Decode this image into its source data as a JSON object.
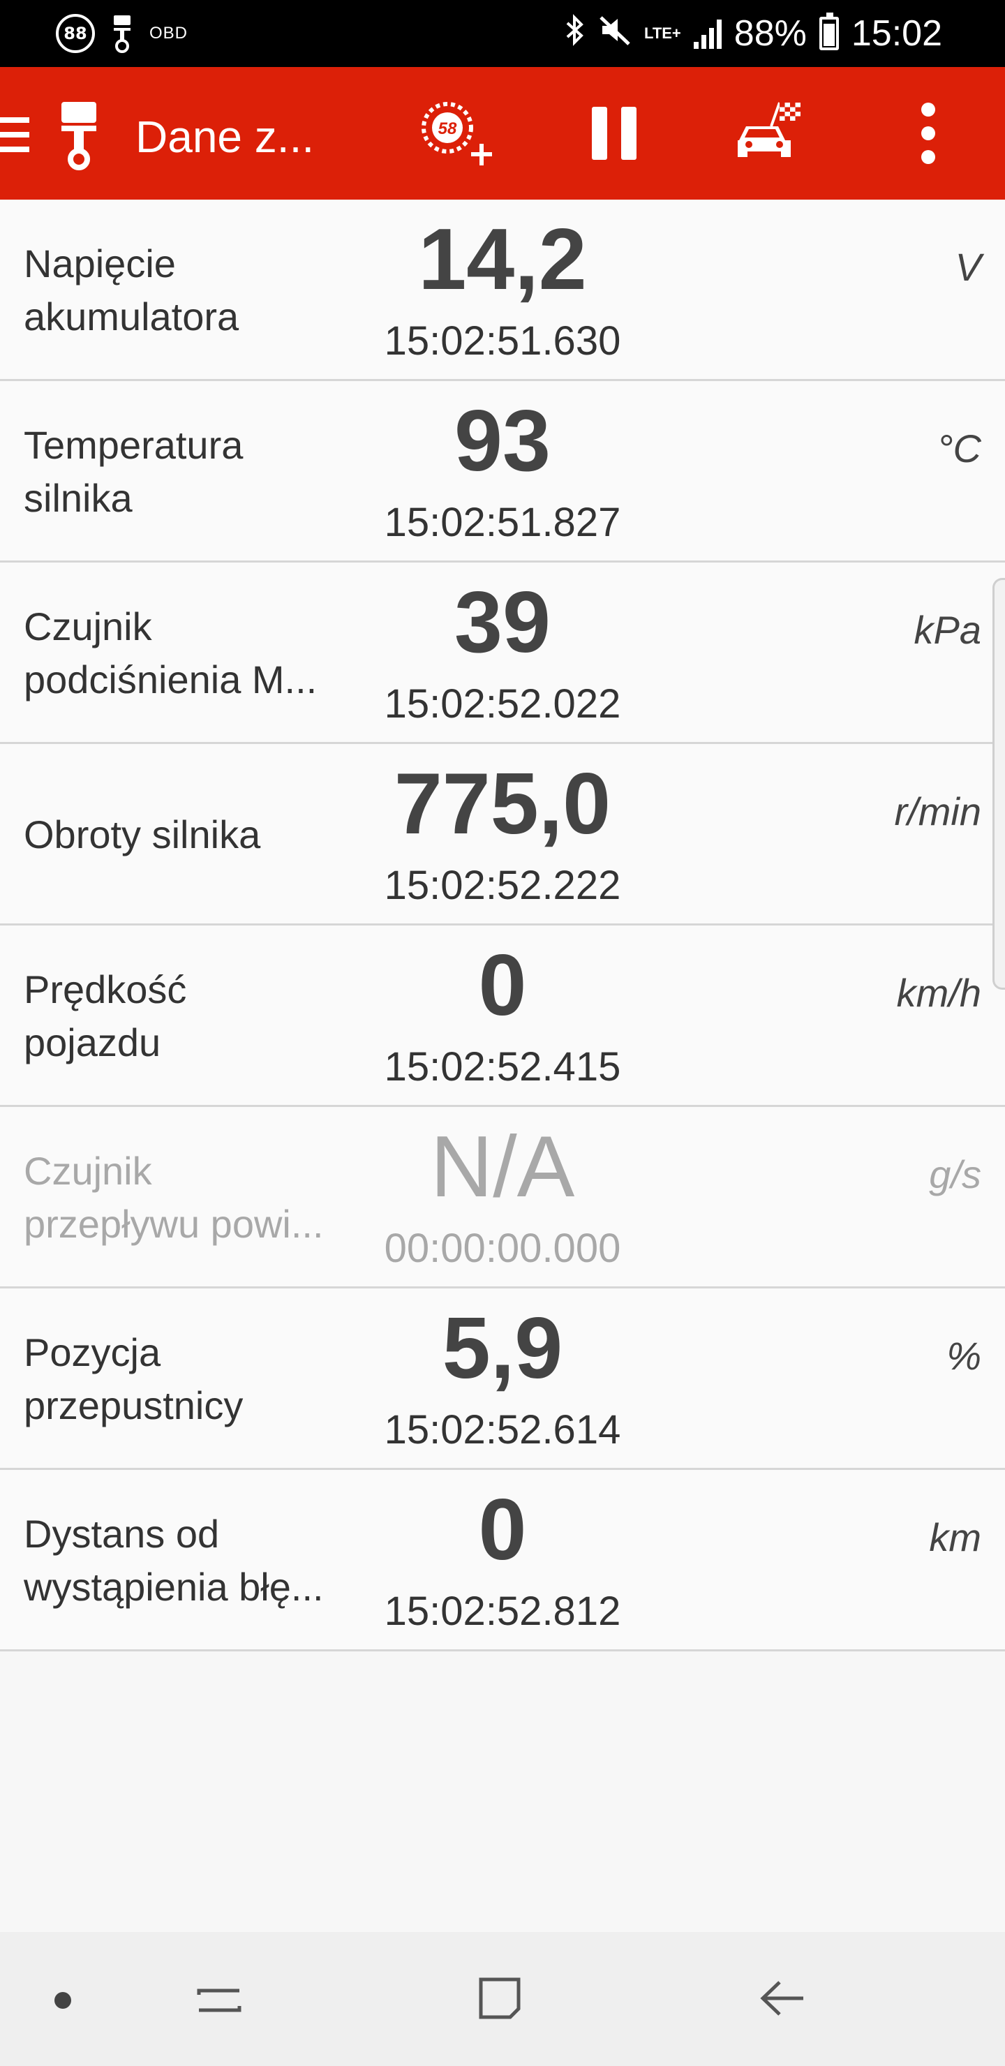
{
  "status_bar": {
    "notif_count": "88",
    "obd_label": "OBD",
    "network": "LTE+",
    "battery": "88%",
    "time": "15:02",
    "icons": [
      "count-badge-icon",
      "piston-notification-icon",
      "bluetooth-icon",
      "mute-icon",
      "signal-icon",
      "battery-icon"
    ]
  },
  "toolbar": {
    "title": "Dane z...",
    "gauge_badge": "58",
    "icons": [
      "menu-icon",
      "piston-icon",
      "add-gauge-icon",
      "pause-icon",
      "race-car-icon",
      "more-icon"
    ],
    "accent": "#dc2008"
  },
  "rows": [
    {
      "label_1": "Napięcie",
      "label_2": "akumulatora",
      "value": "14,2",
      "time": "15:02:51.630",
      "unit": "V"
    },
    {
      "label_1": "Temperatura",
      "label_2": "silnika",
      "value": "93",
      "time": "15:02:51.827",
      "unit": "°C"
    },
    {
      "label_1": "Czujnik",
      "label_2": "podciśnienia M...",
      "value": "39",
      "time": "15:02:52.022",
      "unit": "kPa"
    },
    {
      "label_1": "Obroty silnika",
      "label_2": "",
      "value": "775,0",
      "time": "15:02:52.222",
      "unit": "r/min"
    },
    {
      "label_1": "Prędkość",
      "label_2": "pojazdu",
      "value": "0",
      "time": "15:02:52.415",
      "unit": "km/h"
    },
    {
      "label_1": "Czujnik",
      "label_2": "przepływu powi...",
      "value": "N/A",
      "time": "00:00:00.000",
      "unit": "g/s"
    },
    {
      "label_1": "Pozycja",
      "label_2": "przepustnicy",
      "value": "5,9",
      "time": "15:02:52.614",
      "unit": "%"
    },
    {
      "label_1": "Dystans od",
      "label_2": "wystąpienia błę...",
      "value": "0",
      "time": "15:02:52.812",
      "unit": "km"
    }
  ],
  "nav_bar": {
    "icons": [
      "nav-dot-icon",
      "recent-apps-icon",
      "home-icon",
      "back-icon"
    ]
  }
}
